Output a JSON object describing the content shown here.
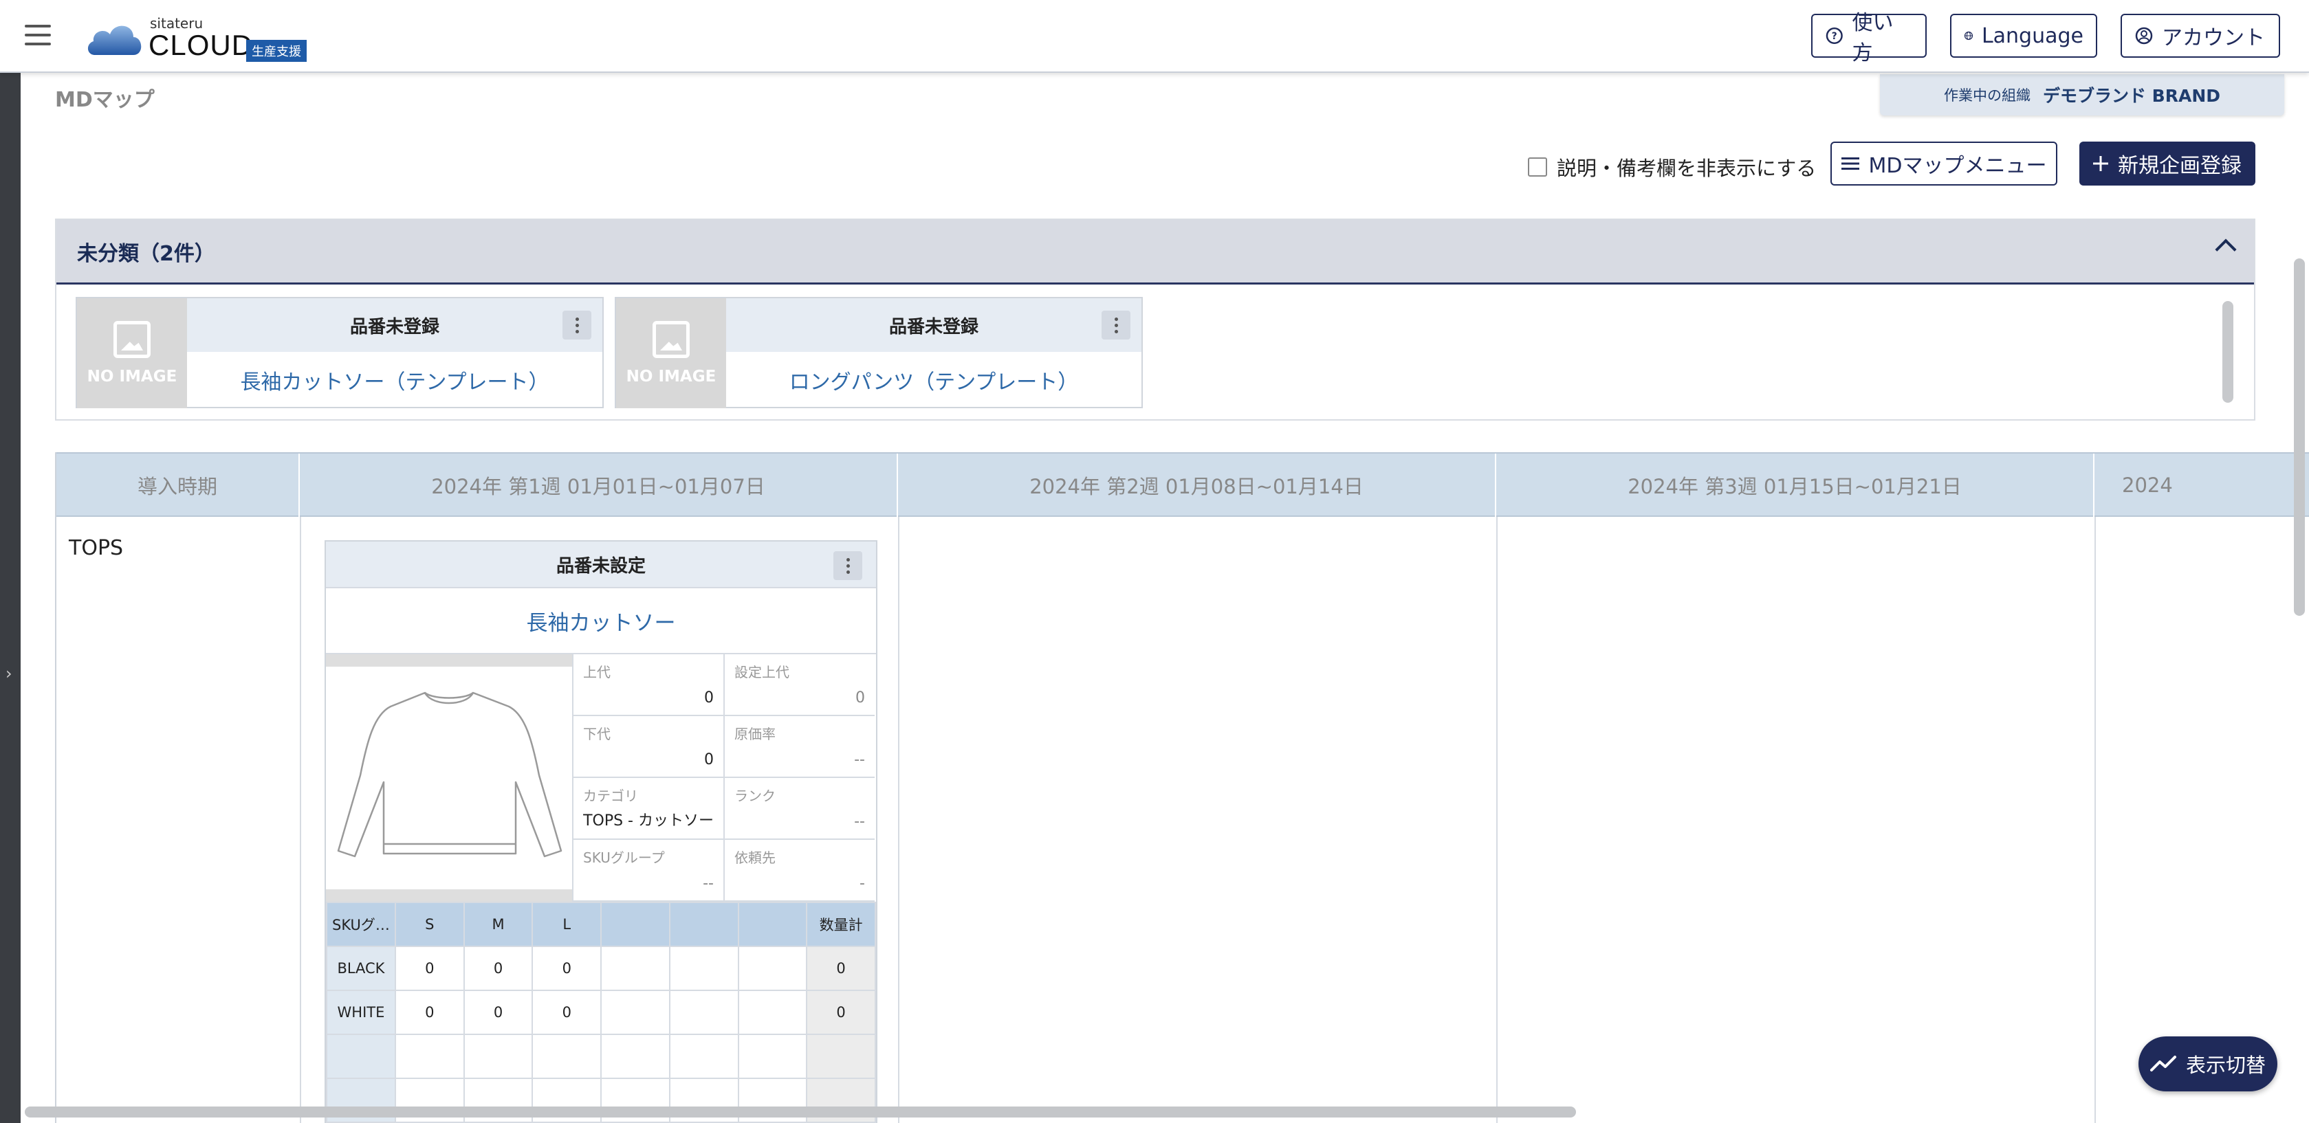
{
  "header": {
    "logo_small": "sitateru",
    "logo_big": "CLOUD",
    "logo_badge": "生産支援",
    "help_label": "使い方",
    "language_label": "Language",
    "account_label": "アカウント"
  },
  "org": {
    "label": "作業中の組織",
    "value": "デモブランド BRAND"
  },
  "page": {
    "title": "MDマップ"
  },
  "toolbar": {
    "hide_notes_label": "説明・備考欄を非表示にする",
    "menu_label": "MDマップメニュー",
    "new_label": "新規企画登録"
  },
  "unclassified": {
    "title": "未分類（2件）",
    "cards": [
      {
        "header": "品番未登録",
        "name": "長袖カットソー（テンプレート）",
        "noimage": "NO IMAGE"
      },
      {
        "header": "品番未登録",
        "name": "ロングパンツ（テンプレート）",
        "noimage": "NO IMAGE"
      }
    ]
  },
  "schedule": {
    "col_label": "導入時期",
    "weeks": [
      "2024年 第1週 01月01日~01月07日",
      "2024年 第2週 01月08日~01月14日",
      "2024年 第3週 01月15日~01月21日",
      "2024"
    ],
    "row_label": "TOPS"
  },
  "product": {
    "header": "品番未設定",
    "name": "長袖カットソー",
    "attrs": {
      "upper_price_k": "上代",
      "upper_price_v": "0",
      "set_upper_k": "設定上代",
      "set_upper_v": "0",
      "lower_price_k": "下代",
      "lower_price_v": "0",
      "cost_rate_k": "原価率",
      "cost_rate_v": "--",
      "category_k": "カテゴリ",
      "category_v": "TOPS - カットソー",
      "rank_k": "ランク",
      "rank_v": "--",
      "sku_group_k": "SKUグループ",
      "sku_group_v": "--",
      "vendor_k": "依頼先",
      "vendor_v": "-"
    },
    "sku": {
      "col0": "SKUグ…",
      "sizes": [
        "S",
        "M",
        "L",
        "",
        "",
        ""
      ],
      "total_label": "数量計",
      "rows": [
        {
          "color": "BLACK",
          "values": [
            "0",
            "0",
            "0",
            "",
            "",
            ""
          ],
          "total": "0"
        },
        {
          "color": "WHITE",
          "values": [
            "0",
            "0",
            "0",
            "",
            "",
            ""
          ],
          "total": "0"
        }
      ]
    }
  },
  "fab": {
    "label": "表示切替"
  }
}
